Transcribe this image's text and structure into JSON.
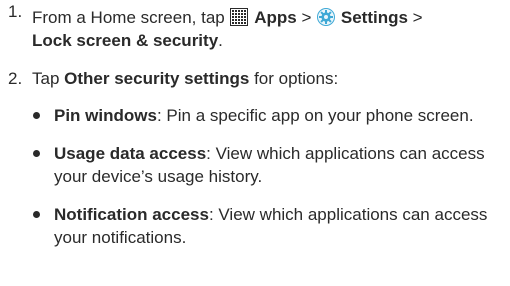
{
  "steps": [
    {
      "number": "1.",
      "text_before": "From a Home screen, tap",
      "apps_icon": "apps-grid-icon",
      "apps_label": "Apps",
      "sep1": ">",
      "settings_icon": "settings-gear-icon",
      "settings_label": "Settings",
      "sep2": ">",
      "lock_label": "Lock screen & security",
      "end": "."
    },
    {
      "number": "2.",
      "text_before": "Tap",
      "bold": "Other security settings",
      "text_after": "for options:"
    }
  ],
  "options": [
    {
      "title": "Pin windows",
      "description": ": Pin a specific app on your phone screen."
    },
    {
      "title": "Usage data access",
      "description": ": View which applications can access your device’s usage history."
    },
    {
      "title": "Notification access",
      "description": ": View which applications can access your notifications."
    }
  ],
  "colors": {
    "text": "#2a2a2a",
    "settings_icon": "#3fa9d6"
  }
}
